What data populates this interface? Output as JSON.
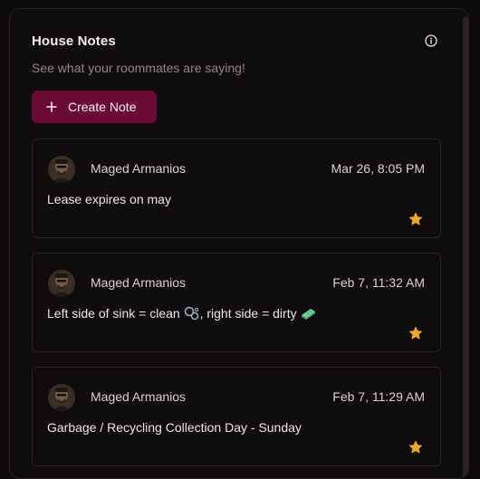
{
  "panel": {
    "title": "House Notes",
    "subtitle": "See what your roommates are saying!",
    "create_label": "Create Note"
  },
  "notes": [
    {
      "author": "Maged Armanios",
      "date": "Mar 26, 8:05 PM",
      "text": "Lease expires on may",
      "starred": true
    },
    {
      "author": "Maged Armanios",
      "date": "Feb 7, 11:32 AM",
      "text_a": "Left side of sink = clean ",
      "text_b": ", right side = dirty ",
      "starred": true
    },
    {
      "author": "Maged Armanios",
      "date": "Feb 7, 11:29 AM",
      "text": "Garbage / Recycling Collection Day - Sunday",
      "starred": true
    }
  ],
  "colors": {
    "accent": "#6b0b35",
    "star": "#f5a623",
    "background": "#0f0c0e"
  },
  "icons": {
    "info": "info-icon",
    "plus": "plus-icon",
    "star": "star-icon",
    "soap": "soap-bubbles-icon",
    "sponge": "sponge-icon"
  }
}
